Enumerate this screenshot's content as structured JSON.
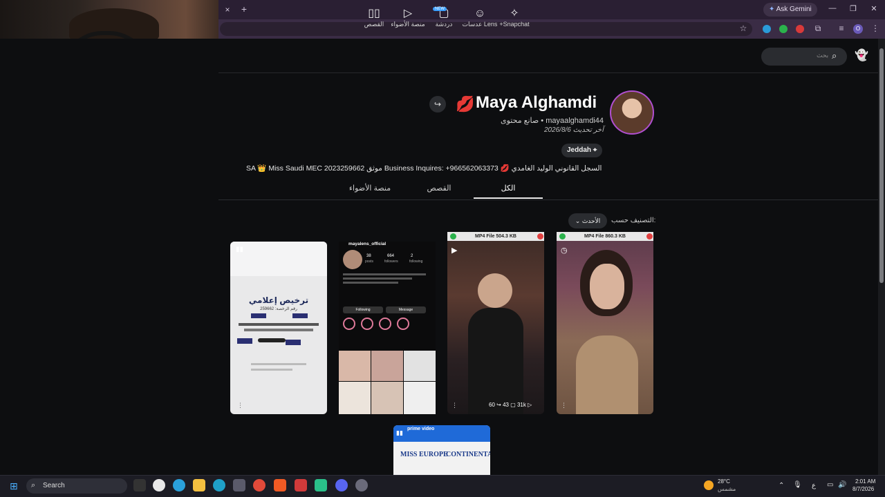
{
  "browser": {
    "new_tab": "+",
    "close_tab": "×",
    "ask_gemini": "Ask Gemini",
    "win_min": "—",
    "win_max": "❐",
    "win_close": "✕",
    "profile_initial": "O"
  },
  "nav": {
    "items": [
      {
        "label": "+Snapchat"
      },
      {
        "label": "عدسات Lens"
      },
      {
        "label": "دردشة",
        "badge": "NEW"
      },
      {
        "label": "منصة الأضواء"
      },
      {
        "label": "القصص"
      }
    ],
    "search_placeholder": "بحث"
  },
  "profile": {
    "name": "Maya Alghamdi",
    "handle_line": "mayaalghamdi44 • صانع محتوى",
    "updated": "آخر تحديث 2026/8/6",
    "location": "Jeddah",
    "bio": "SA 👑 Miss Saudi MEC 2023موثق 259662 Business Inquires: +966562063373 💋 السجل القانوني الوليد الغامدي 🎂"
  },
  "tabs": {
    "all": "الكل",
    "stories": "القصص",
    "spotlight": "منصة الأضواء"
  },
  "sort": {
    "label": "التصنيف حسب:",
    "value": "الأحدث"
  },
  "thumbs": [
    {
      "type": "license",
      "title": "ترخيص إعلامي",
      "sub": "رقم الرخصة: 259662"
    },
    {
      "type": "instagram",
      "account": "mayalens_official",
      "posts": "38",
      "followers": "664",
      "following": "2",
      "posts_label": "posts",
      "followers_label": "followers",
      "following_label": "following",
      "follow_btn": "Following",
      "msg_btn": "Message"
    },
    {
      "type": "video",
      "header": "MP4 File 504.3 KB",
      "views": "31k",
      "comments": "43",
      "shares": "60"
    },
    {
      "type": "video",
      "header": "MP4 File 860.3 KB"
    },
    {
      "type": "banner",
      "brand": "prime video",
      "left": "MISS EUROPE",
      "right": "CONTINENTAL"
    }
  ],
  "taskbar": {
    "search": "Search",
    "weather_temp": "28°C",
    "weather_desc": "مشمس",
    "lang": "ع",
    "time": "2:01 AM",
    "date": "8/7/2026"
  },
  "colors": {
    "accent_ring": "#b04fd0",
    "snap_yellow": "#fffc00"
  }
}
